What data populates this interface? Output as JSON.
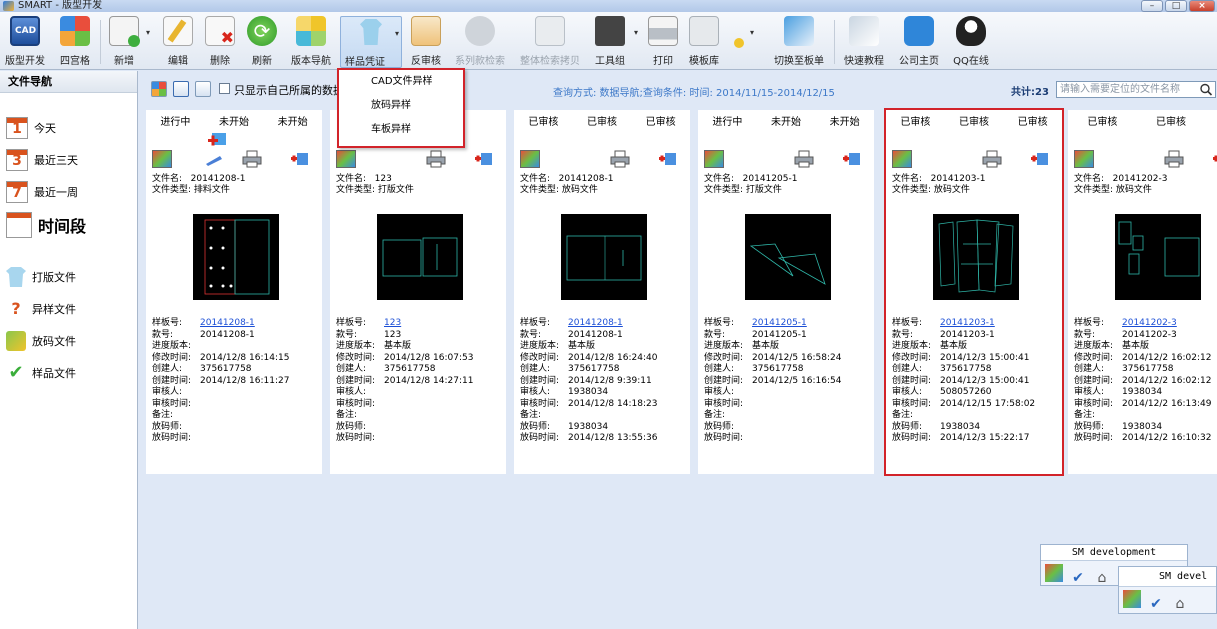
{
  "window": {
    "title": "SMART - 版型开发"
  },
  "toolbar": {
    "items": [
      {
        "label": "版型开发"
      },
      {
        "label": "四宫格"
      },
      {
        "label": "新增"
      },
      {
        "label": "编辑"
      },
      {
        "label": "删除"
      },
      {
        "label": "刷新"
      },
      {
        "label": "版本导航"
      },
      {
        "label": "样品凭证"
      },
      {
        "label": "反审核"
      },
      {
        "label": "系列款检索"
      },
      {
        "label": "整体检索拷贝"
      },
      {
        "label": "工具组"
      },
      {
        "label": "打印"
      },
      {
        "label": "模板库"
      },
      {
        "label": "切换至板单"
      },
      {
        "label": "快速教程"
      },
      {
        "label": "公司主页"
      },
      {
        "label": "QQ在线"
      }
    ]
  },
  "dropdown": {
    "items": [
      "CAD文件异样",
      "放码异样",
      "车板异样"
    ]
  },
  "sidebar": {
    "title": "文件导航",
    "dates": [
      {
        "num": "1",
        "label": "今天"
      },
      {
        "num": "3",
        "label": "最近三天"
      },
      {
        "num": "7",
        "label": "最近一周"
      },
      {
        "num": "",
        "label": "时间段"
      }
    ],
    "categories": [
      "打版文件",
      "异样文件",
      "放码文件",
      "样品文件"
    ]
  },
  "filter": {
    "only_own_label": "只显示自己所属的数据",
    "query": "查询方式: 数据导航;查询条件: 时间: 2014/11/15-2014/12/15",
    "count_label": "共计:",
    "count": "23",
    "search_placeholder": "请输入需要定位的文件名称"
  },
  "labels": {
    "file_name": "文件名:",
    "file_type": "文件类型:",
    "sample_no": "样板号:",
    "style_no": "款号:",
    "progress": "进度版本:",
    "modified": "修改时间:",
    "creator": "创建人:",
    "created": "创建时间:",
    "reviewer": "审核人:",
    "reviewed": "审核时间:",
    "remark": "备注:",
    "grader": "放码师:",
    "graded": "放码时间:"
  },
  "cards": [
    {
      "status": [
        "进行中",
        "未开始",
        "未开始"
      ],
      "file_name": "20141208-1",
      "file_type": "排料文件",
      "sample_no": "20141208-1",
      "style_no": "20141208-1",
      "progress": "",
      "modified": "2014/12/8 16:14:15",
      "creator": "375617758",
      "created": "2014/12/8 16:11:27",
      "reviewer": "",
      "reviewed": "",
      "remark": "",
      "grader": "",
      "graded": ""
    },
    {
      "status": [
        "",
        "",
        ""
      ],
      "file_name": "123",
      "file_type": "打版文件",
      "sample_no": "123",
      "style_no": "123",
      "progress": "基本版",
      "modified": "2014/12/8 16:07:53",
      "creator": "375617758",
      "created": "2014/12/8 14:27:11",
      "reviewer": "",
      "reviewed": "",
      "remark": "",
      "grader": "",
      "graded": ""
    },
    {
      "status": [
        "已审核",
        "已审核",
        "已审核"
      ],
      "file_name": "20141208-1",
      "file_type": "放码文件",
      "sample_no": "20141208-1",
      "style_no": "20141208-1",
      "progress": "基本版",
      "modified": "2014/12/8 16:24:40",
      "creator": "375617758",
      "created": "2014/12/8 9:39:11",
      "reviewer": "1938034",
      "reviewed": "2014/12/8 14:18:23",
      "remark": "",
      "grader": "1938034",
      "graded": "2014/12/8 13:55:36"
    },
    {
      "status": [
        "进行中",
        "未开始",
        "未开始"
      ],
      "file_name": "20141205-1",
      "file_type": "打版文件",
      "sample_no": "20141205-1",
      "style_no": "20141205-1",
      "progress": "基本版",
      "modified": "2014/12/5 16:58:24",
      "creator": "375617758",
      "created": "2014/12/5 16:16:54",
      "reviewer": "",
      "reviewed": "",
      "remark": "",
      "grader": "",
      "graded": ""
    },
    {
      "status": [
        "已审核",
        "已审核",
        "已审核"
      ],
      "file_name": "20141203-1",
      "file_type": "放码文件",
      "sample_no": "20141203-1",
      "style_no": "20141203-1",
      "progress": "基本版",
      "modified": "2014/12/3 15:00:41",
      "creator": "375617758",
      "created": "2014/12/3 15:00:41",
      "reviewer": "508057260",
      "reviewed": "2014/12/15 17:58:02",
      "remark": "",
      "grader": "1938034",
      "graded": "2014/12/3 15:22:17"
    },
    {
      "status": [
        "已审核",
        "已审核",
        ""
      ],
      "file_name": "20141202-3",
      "file_type": "放码文件",
      "sample_no": "20141202-3",
      "style_no": "20141202-3",
      "progress": "基本版",
      "modified": "2014/12/2 16:02:12",
      "creator": "375617758",
      "created": "2014/12/2 16:02:12",
      "reviewer": "1938034",
      "reviewed": "2014/12/2 16:13:49",
      "remark": "",
      "grader": "1938034",
      "graded": "2014/12/2 16:10:32"
    }
  ],
  "floating": [
    {
      "title": "SM development"
    },
    {
      "title": "SM devel"
    }
  ],
  "colors": {
    "highlight": "#d2232a",
    "link": "#1c4fd6",
    "query": "#3c78c8",
    "pattern_line": "#2fb6a8"
  }
}
